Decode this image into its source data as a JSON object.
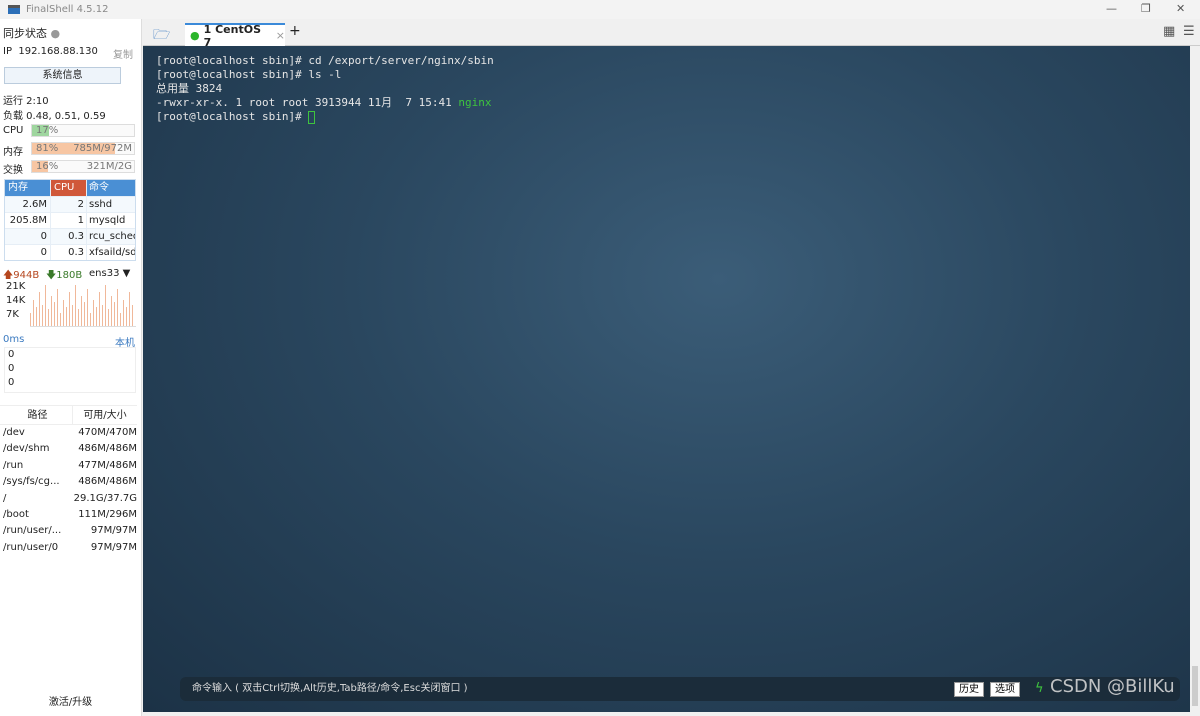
{
  "app": {
    "title": "FinalShell 4.5.12"
  },
  "sidebar": {
    "sync_label": "同步状态",
    "ip_label": "IP",
    "ip": "192.168.88.130",
    "copy": "复制",
    "sysinfo_button": "系统信息",
    "uptime": "运行 2:10",
    "load": "负载 0.48, 0.51, 0.59",
    "cpu": {
      "label": "CPU",
      "percent": "17%",
      "value": 17
    },
    "mem": {
      "label": "内存",
      "percent": "81%",
      "detail": "785M/972M",
      "value": 81
    },
    "swap": {
      "label": "交换",
      "percent": "16%",
      "detail": "321M/2G",
      "value": 16
    },
    "proc_headers": [
      "内存",
      "CPU",
      "命令"
    ],
    "processes": [
      {
        "mem": "2.6M",
        "cpu": "2",
        "cmd": "sshd"
      },
      {
        "mem": "205.8M",
        "cpu": "1",
        "cmd": "mysqld"
      },
      {
        "mem": "0",
        "cpu": "0.3",
        "cmd": "rcu_sched"
      },
      {
        "mem": "0",
        "cpu": "0.3",
        "cmd": "xfsaild/sd-"
      }
    ],
    "net": {
      "up": "944B",
      "down": "180B",
      "iface": "ens33",
      "ticks": [
        "21K",
        "14K",
        "7K"
      ]
    },
    "ping": {
      "latency": "0ms",
      "target": "本机",
      "values": [
        "0",
        "0",
        "0"
      ]
    },
    "disk_headers": [
      "路径",
      "可用/大小"
    ],
    "disks": [
      {
        "path": "/dev",
        "size": "470M/470M"
      },
      {
        "path": "/dev/shm",
        "size": "486M/486M"
      },
      {
        "path": "/run",
        "size": "477M/486M"
      },
      {
        "path": "/sys/fs/cg...",
        "size": "486M/486M"
      },
      {
        "path": "/",
        "size": "29.1G/37.7G"
      },
      {
        "path": "/boot",
        "size": "111M/296M"
      },
      {
        "path": "/run/user/...",
        "size": "97M/97M"
      },
      {
        "path": "/run/user/0",
        "size": "97M/97M"
      }
    ],
    "activate": "激活/升级"
  },
  "tabs": [
    {
      "label": "1 CentOS 7"
    }
  ],
  "terminal": {
    "lines": [
      "[root@localhost sbin]# cd /export/server/nginx/sbin",
      "[root@localhost sbin]# ls -l",
      "总用量 3824",
      "-rwxr-xr-x. 1 root root 3913944 11月  7 15:41 "
    ],
    "highlight": "nginx",
    "prompt": "[root@localhost sbin]# "
  },
  "cmdbar": {
    "placeholder": "命令输入 ( 双击Ctrl切换,Alt历史,Tab路径/命令,Esc关闭窗口 )",
    "history": "历史",
    "options": "选项"
  },
  "watermark": "CSDN @BillKu",
  "colors": {
    "accent": "#3b8ad9",
    "cpu": "#9fd69f",
    "mem": "#f7c6a3",
    "highlight": "#3ec43e"
  }
}
